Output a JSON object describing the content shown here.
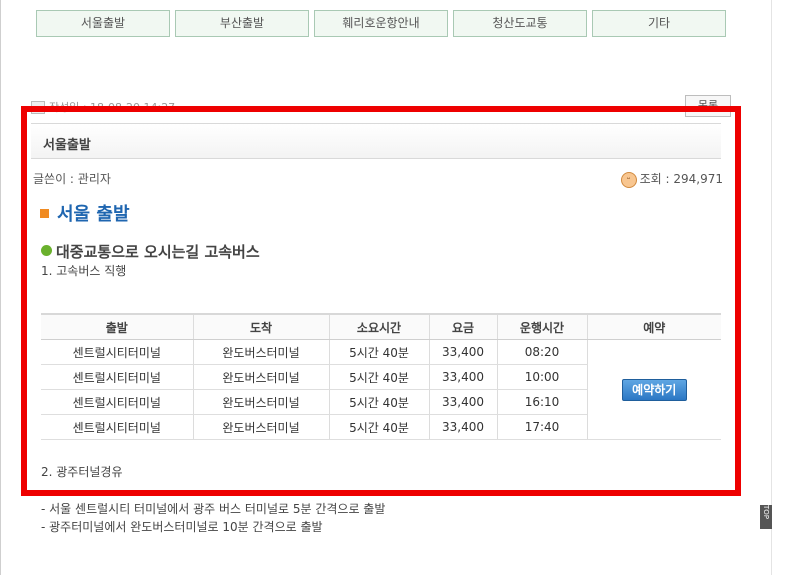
{
  "tabs": [
    "서울출발",
    "부산출발",
    "훼리호운항안내",
    "청산도교통",
    "기타"
  ],
  "board": {
    "written_label": "작성일 : 18-08-20 14:27",
    "list_button": "목록"
  },
  "post": {
    "title": "서울출발",
    "author": "글쓴이 : 관리자",
    "views": "조회 : 294,971",
    "heading": "서울 출발",
    "subheading": "대중교통으로 오시는길 고속버스",
    "item1": "1. 고속버스 직행",
    "item2": "2. 광주터널경유"
  },
  "table": {
    "headers": [
      "출발",
      "도착",
      "소요시간",
      "요금",
      "운행시간",
      "예약"
    ],
    "rows": [
      [
        "센트럴시티터미널",
        "완도버스터미널",
        "5시간 40분",
        "33,400",
        "08:20"
      ],
      [
        "센트럴시티터미널",
        "완도버스터미널",
        "5시간 40분",
        "33,400",
        "10:00"
      ],
      [
        "센트럴시티터미널",
        "완도버스터미널",
        "5시간 40분",
        "33,400",
        "16:10"
      ],
      [
        "센트럴시티터미널",
        "완도버스터미널",
        "5시간 40분",
        "33,400",
        "17:40"
      ]
    ],
    "book_button": "예약하기"
  },
  "notes": [
    "- 서울 센트럴시티 터미널에서 광주 버스 터미널로 5분 간격으로 출발",
    "- 광주터미널에서 완도버스터미널로 10분 간격으로 출발"
  ],
  "top_button": "TOP",
  "highlight_color": "#ee0000",
  "icons": [
    "document-icon",
    "smiley-icon",
    "orange-square-icon",
    "green-bullet-icon"
  ]
}
